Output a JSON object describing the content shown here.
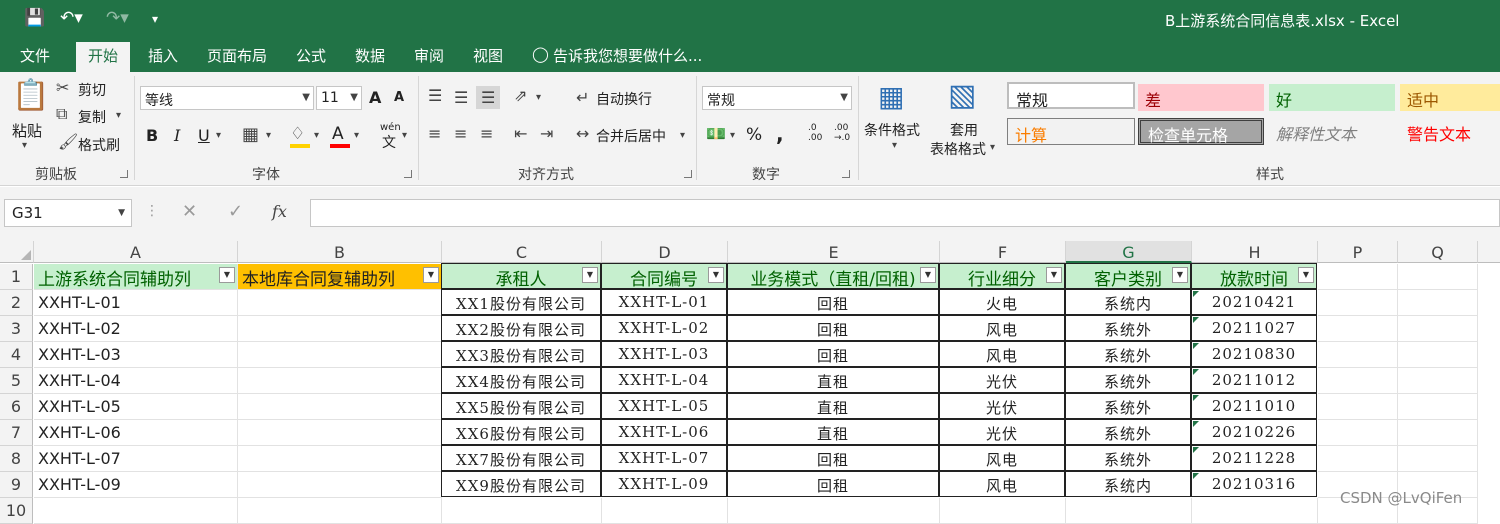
{
  "window": {
    "title": "B上游系统合同信息表.xlsx - Excel"
  },
  "menu": {
    "tabs": [
      "文件",
      "开始",
      "插入",
      "页面布局",
      "公式",
      "数据",
      "审阅",
      "视图"
    ],
    "tell_me": "告诉我您想要做什么..."
  },
  "ribbon": {
    "clipboard": {
      "paste": "粘贴",
      "cut": "剪切",
      "copy": "复制",
      "format_painter": "格式刷",
      "label": "剪贴板"
    },
    "font": {
      "name": "等线",
      "size": "11",
      "label": "字体",
      "grow": "A",
      "shrink": "A",
      "bold": "B",
      "italic": "I",
      "underline": "U",
      "color_a": "A",
      "wen": "wén",
      "wen2": "文"
    },
    "alignment": {
      "wrap": "自动换行",
      "merge": "合并后居中",
      "label": "对齐方式"
    },
    "number": {
      "format": "常规",
      "percent": "%",
      "comma": ",",
      "inc": ".0",
      "inc2": ".00",
      "dec": ".00",
      "dec2": "→.0",
      "label": "数字"
    },
    "styles": {
      "conditional": "条件格式",
      "table_line1": "套用",
      "table_line2": "表格格式",
      "cells": [
        "常规",
        "差",
        "好",
        "适中",
        "计算",
        "检查单元格",
        "解释性文本",
        "警告文本"
      ],
      "label": "样式"
    }
  },
  "formula_bar": {
    "name_box": "G31",
    "fx": "fx",
    "formula": ""
  },
  "sheet": {
    "columns": [
      "A",
      "B",
      "C",
      "D",
      "E",
      "F",
      "G",
      "H",
      "P",
      "Q"
    ],
    "selected_column": "G",
    "rows": [
      "1",
      "2",
      "3",
      "4",
      "5",
      "6",
      "7",
      "8",
      "9",
      "10"
    ],
    "header": {
      "A": "上游系统合同辅助列",
      "B": "本地库合同复辅助列",
      "C": "承租人",
      "D": "合同编号",
      "E": "业务模式（直租/回租)",
      "F": "行业细分",
      "G": "客户类别",
      "H": "放款时间"
    },
    "data": [
      {
        "A": "XXHT-L-01",
        "C": "XX1股份有限公司",
        "D": "XXHT-L-01",
        "E": "回租",
        "F": "火电",
        "G": "系统内",
        "H": "20210421"
      },
      {
        "A": "XXHT-L-02",
        "C": "XX2股份有限公司",
        "D": "XXHT-L-02",
        "E": "回租",
        "F": "风电",
        "G": "系统外",
        "H": "20211027"
      },
      {
        "A": "XXHT-L-03",
        "C": "XX3股份有限公司",
        "D": "XXHT-L-03",
        "E": "回租",
        "F": "风电",
        "G": "系统外",
        "H": "20210830"
      },
      {
        "A": "XXHT-L-04",
        "C": "XX4股份有限公司",
        "D": "XXHT-L-04",
        "E": "直租",
        "F": "光伏",
        "G": "系统外",
        "H": "20211012"
      },
      {
        "A": "XXHT-L-05",
        "C": "XX5股份有限公司",
        "D": "XXHT-L-05",
        "E": "直租",
        "F": "光伏",
        "G": "系统外",
        "H": "20211010"
      },
      {
        "A": "XXHT-L-06",
        "C": "XX6股份有限公司",
        "D": "XXHT-L-06",
        "E": "直租",
        "F": "光伏",
        "G": "系统外",
        "H": "20210226"
      },
      {
        "A": "XXHT-L-07",
        "C": "XX7股份有限公司",
        "D": "XXHT-L-07",
        "E": "回租",
        "F": "风电",
        "G": "系统外",
        "H": "20211228"
      },
      {
        "A": "XXHT-L-09",
        "C": "XX9股份有限公司",
        "D": "XXHT-L-09",
        "E": "回租",
        "F": "风电",
        "G": "系统内",
        "H": "20210316"
      }
    ]
  },
  "watermark": "CSDN @LvQiFen",
  "colors": {
    "excel_green": "#217346",
    "header_a_fill": "#c6efce",
    "header_b_fill": "#ffc000",
    "bad_fill": "#ffc7ce",
    "neutral_fill": "#ffeb9c"
  }
}
